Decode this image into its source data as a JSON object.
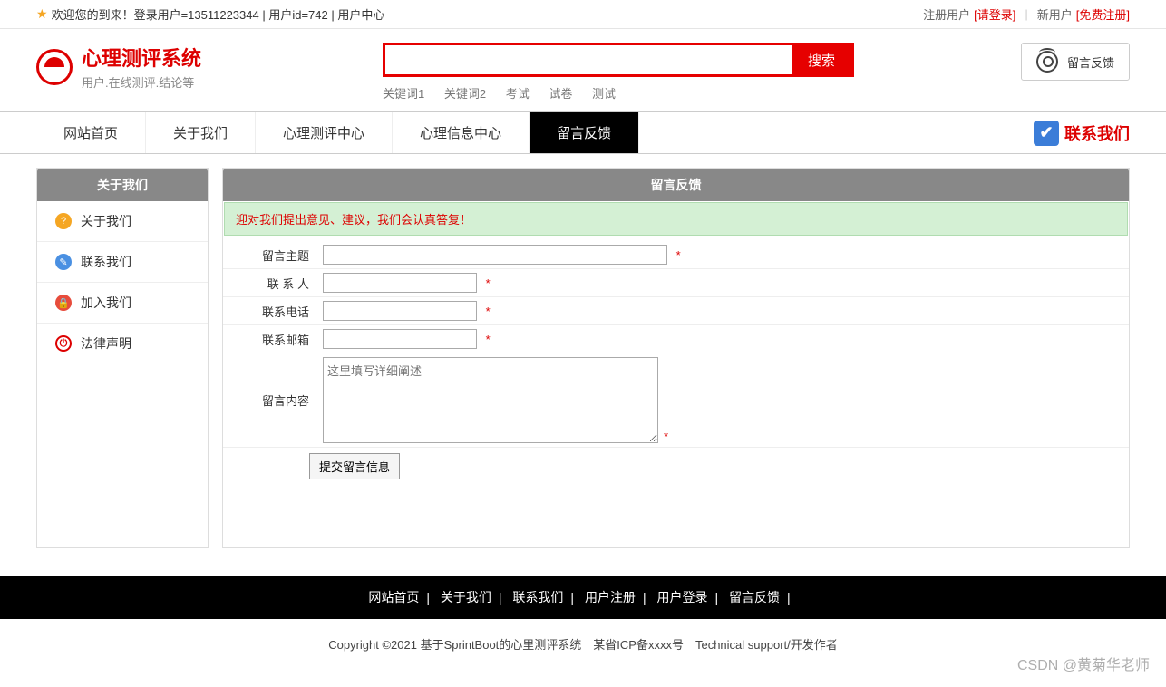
{
  "topbar": {
    "welcome": "欢迎您的到来！登录用户=13511223344 | 用户id=742 | 用户中心",
    "reg_user_label": "注册用户",
    "login_link": "[请登录]",
    "new_user_label": "新用户",
    "free_reg_link": "[免费注册]"
  },
  "logo": {
    "title": "心理测评系统",
    "subtitle": "用户.在线测评.结论等"
  },
  "search": {
    "button": "搜索",
    "keywords": [
      "关键词1",
      "关键词2",
      "考试",
      "试卷",
      "测试"
    ]
  },
  "header_feedback_btn": "留言反馈",
  "nav": {
    "items": [
      "网站首页",
      "关于我们",
      "心理测评中心",
      "心理信息中心",
      "留言反馈"
    ],
    "active_index": 4,
    "contact": "联系我们"
  },
  "sidebar": {
    "title": "关于我们",
    "items": [
      {
        "label": "关于我们",
        "icon": "orange",
        "glyph": "?"
      },
      {
        "label": "联系我们",
        "icon": "blue",
        "glyph": "✎"
      },
      {
        "label": "加入我们",
        "icon": "red",
        "glyph": "🔒"
      },
      {
        "label": "法律声明",
        "icon": "power",
        "glyph": "⏻"
      }
    ]
  },
  "content": {
    "title": "留言反馈",
    "tip": "迎对我们提出意见、建议，我们会认真答复！",
    "form": {
      "subject_label": "留言主题",
      "contact_label": "联 系 人",
      "phone_label": "联系电话",
      "email_label": "联系邮箱",
      "body_label": "留言内容",
      "body_placeholder": "这里填写详细阐述",
      "required_mark": "*",
      "submit": "提交留言信息"
    }
  },
  "footer": {
    "links": [
      "网站首页",
      "关于我们",
      "联系我们",
      "用户注册",
      "用户登录",
      "留言反馈"
    ],
    "copyright": "Copyright ©2021 基于SprintBoot的心里测评系统　某省ICP备xxxx号　Technical support/开发作者"
  },
  "watermark": "CSDN @黄菊华老师"
}
